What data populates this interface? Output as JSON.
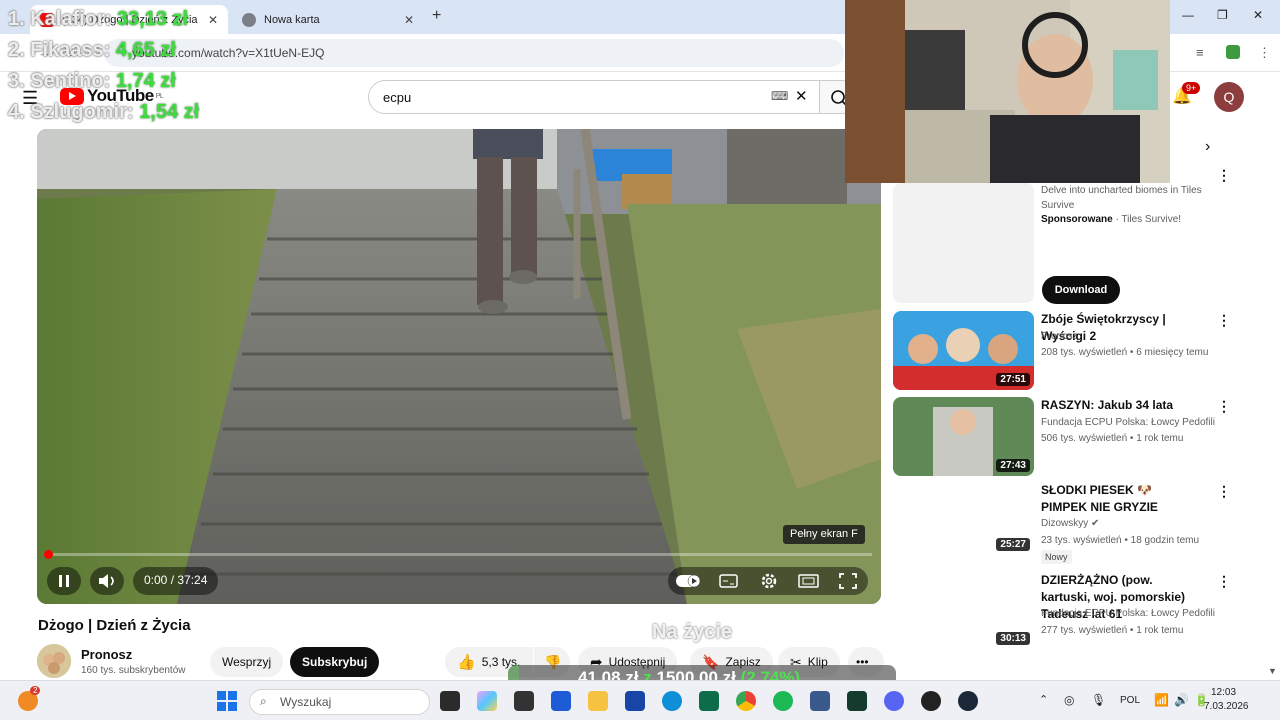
{
  "browser": {
    "tabs": [
      {
        "title": "(134) Dżogo | Dzień z Życia",
        "active": true
      },
      {
        "title": "Nowa karta",
        "active": false
      }
    ],
    "address": "youtube.com/watch?v=X1tUeN-EJQ"
  },
  "youtube": {
    "logo": "YouTube",
    "logo_region": "PL",
    "search_value": "ecpu",
    "notifications_badge": "9+",
    "account_initial": "Q"
  },
  "leaderboard": [
    {
      "name": "1. Kalafior:",
      "amount": "33,13 zł"
    },
    {
      "name": "2. Fikaass:",
      "amount": "4,65 zł"
    },
    {
      "name": "3. Sentino:",
      "amount": "1,74 zł"
    },
    {
      "name": "4. Szlugomir:",
      "amount": "1,54 zł"
    }
  ],
  "player": {
    "time": "0:00 / 37:24",
    "tooltip": "Pełny ekran  F",
    "progress": 0.0
  },
  "video": {
    "title": "Dżogo | Dzień z Życia",
    "channel": "Pronosz",
    "subscribers": "160 tys. subskrybentów",
    "support_label": "Wesprzyj",
    "subscribe_label": "Subskrybuj",
    "likes": "5,3 tys.",
    "share_label": "Udostępnij",
    "save_label": "Zapisz",
    "clip_label": "Klip",
    "more_label": "•••"
  },
  "overlay": {
    "goal_caption": "Na życie",
    "goal_amount": "41,08 zł",
    "goal_separator": "z",
    "goal_target": "1500,00 zł",
    "goal_percent": "(2.74%)",
    "goal_fraction": 0.0274
  },
  "sidebar": {
    "ad": {
      "description": "Delve into uncharted biomes in Tiles Survive",
      "sponsored_label": "Sponsorowane",
      "advertiser": "Tiles Survive!",
      "cta": "Download"
    },
    "items": [
      {
        "title": "Zbóje Świętokrzyscy | Wyścigi 2",
        "channel": "Pronosz",
        "meta": "208 tys. wyświetleń • 6 miesięcy temu",
        "duration": "27:51"
      },
      {
        "title": "RASZYN: Jakub 34 lata",
        "channel": "Fundacja ECPU Polska: Łowcy Pedofili",
        "meta": "506 tys. wyświetleń • 1 rok temu",
        "duration": "27:43"
      },
      {
        "title": "SŁODKI PIESEK 🐶 PIMPEK NIE GRYZIE",
        "channel": "Dizowskyy ✔",
        "meta": "23 tys. wyświetleń • 18 godzin temu",
        "duration": "25:27",
        "badge": "Nowy"
      },
      {
        "title": "DZIERŻĄŻNO (pow. kartuski, woj. pomorskie) Tadeusz lat 61",
        "channel": "Fundacja ECPU Polska: Łowcy Pedofili",
        "meta": "277 tys. wyświetleń • 1 rok temu",
        "duration": "30:13"
      }
    ]
  },
  "taskbar": {
    "search_placeholder": "Wyszukaj",
    "language": "POL",
    "time": "12:03",
    "date": "7.03.2026",
    "weather_badge": "2"
  }
}
